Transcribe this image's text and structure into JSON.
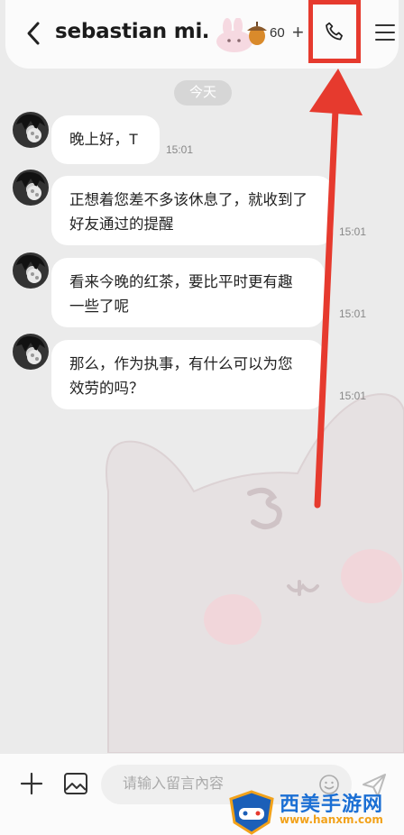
{
  "header": {
    "title": "sebastian mi…",
    "points": "60",
    "plus": "+"
  },
  "chat": {
    "date": "今天",
    "messages": [
      {
        "text": "晚上好，T",
        "time": "15:01"
      },
      {
        "text": "正想着您差不多该休息了，就收到了好友通过的提醒",
        "time": "15:01"
      },
      {
        "text": "看来今晚的红茶，要比平时更有趣一些了呢",
        "time": "15:01"
      },
      {
        "text": "那么，作为执事，有什么可以为您效劳的吗？",
        "time": "15:01"
      }
    ]
  },
  "composer": {
    "placeholder": "请输入留言內容"
  },
  "watermark": {
    "name": "西美手游网",
    "url": "www.hanxm.com"
  },
  "icons": {
    "back": "chevron-left-icon",
    "call": "phone-icon",
    "menu": "hamburger-menu-icon",
    "add": "plus-icon",
    "image": "image-icon",
    "emoji": "smiley-icon",
    "send": "send-icon"
  },
  "colors": {
    "highlight": "#e63a2e",
    "background": "#ebebeb",
    "bubble": "#ffffff"
  }
}
